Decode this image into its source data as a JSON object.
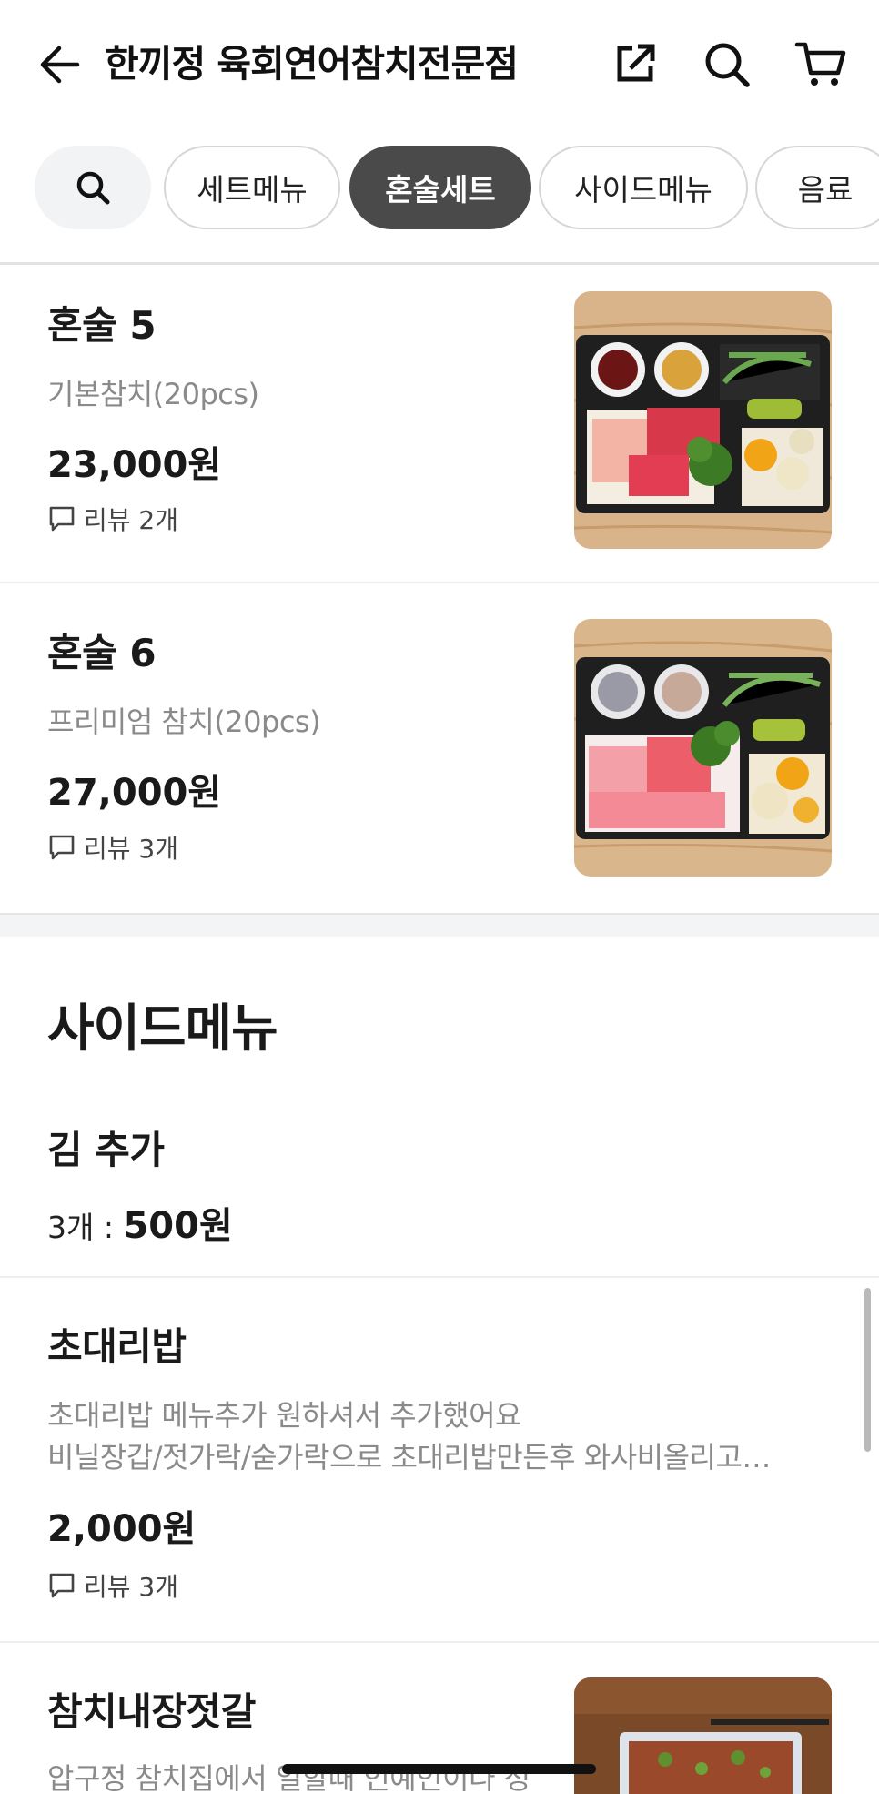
{
  "header": {
    "title": "한끼정 육회연어참치전문점",
    "back_icon": "arrow-left-icon",
    "share_icon": "share-icon",
    "search_icon": "search-icon",
    "cart_icon": "cart-icon"
  },
  "tabs": [
    {
      "label": "세트메뉴",
      "active": false
    },
    {
      "label": "혼술세트",
      "active": true
    },
    {
      "label": "사이드메뉴",
      "active": false
    },
    {
      "label": "음료",
      "active": false
    }
  ],
  "items": [
    {
      "name": "혼술 5",
      "desc": "기본참치(20pcs)",
      "price": "23,000원",
      "reviews": "리뷰 2개"
    },
    {
      "name": "혼술 6",
      "desc": "프리미엄 참치(20pcs)",
      "price": "27,000원",
      "reviews": "리뷰 3개"
    }
  ],
  "side_section": {
    "title": "사이드메뉴",
    "items": [
      {
        "name": "김 추가",
        "qty": "3개 : ",
        "price": "500원"
      },
      {
        "name": "초대리밥",
        "desc_line1": "초대리밥 메뉴추가 원하셔서 추가했어요",
        "desc_line2": "비닐장갑/젓가락/숟가락으로 초대리밥만든후 와사비올리고…",
        "price": "2,000원",
        "reviews": "리뷰 3개"
      },
      {
        "name": "참치내장젓갈",
        "desc": "압구정 참치집에서 일할때 인예인이나 성"
      }
    ]
  },
  "colors": {
    "active_tab": "#4a4a4a",
    "divider": "#e6e6e6",
    "muted_text": "#8a8a8a"
  }
}
